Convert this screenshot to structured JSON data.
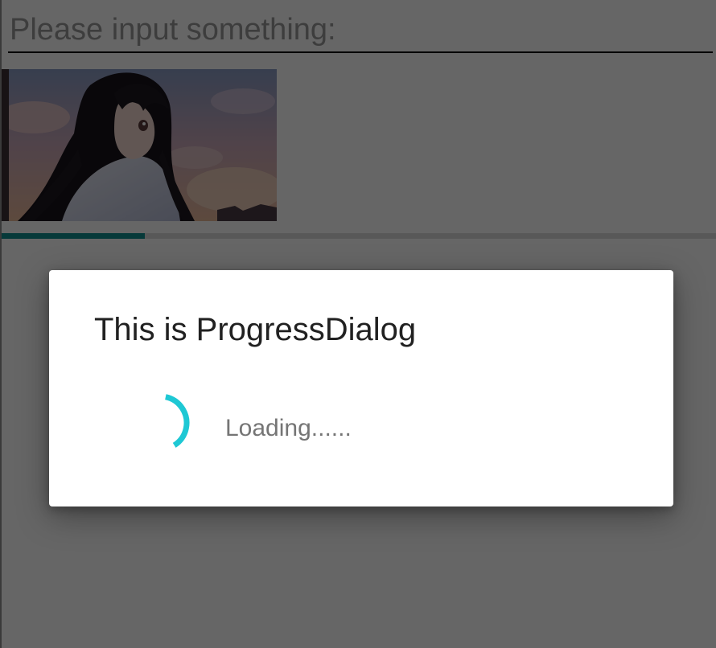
{
  "input": {
    "placeholder": "Please input something:",
    "value": ""
  },
  "image": {
    "subject": "anime girl with long black hair looking up at evening sky"
  },
  "progress_bar": {
    "progress": 0.2,
    "color": "#0f8f8f"
  },
  "dialog": {
    "title": "This is ProgressDialog",
    "message": "Loading......",
    "spinner_color": "#1ec8d4"
  }
}
